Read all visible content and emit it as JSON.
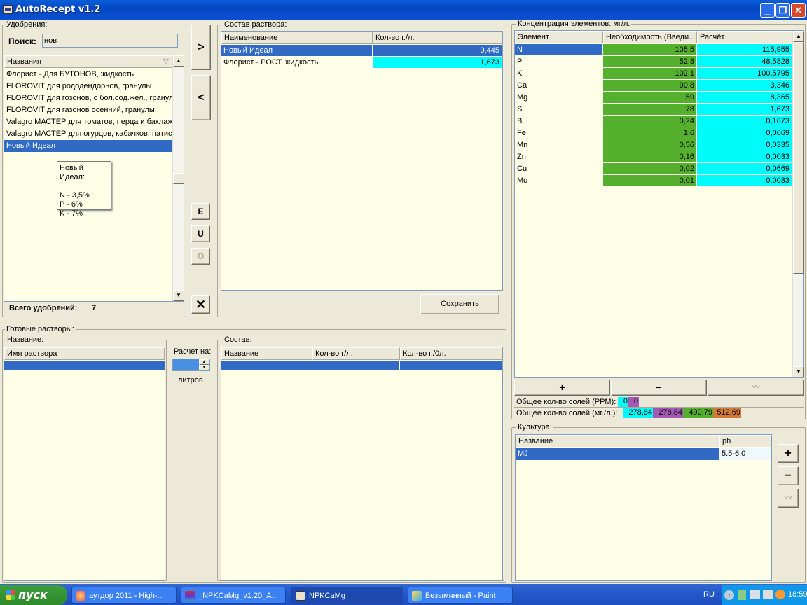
{
  "window": {
    "title": "AutoRecept v1.2",
    "controls": [
      "_",
      "❐",
      "✕"
    ]
  },
  "fertilizers": {
    "group_title": "Удобрения:",
    "search_label": "Поиск:",
    "search_value": "нов",
    "column": "Названия",
    "items": [
      "Флорист - Для БУТОНОВ, жидкость",
      "FLOROVIT для рододендорнов, гранулы",
      "FLOROVIT для гозонов, с бол.сод.жел., гранулы",
      "FLOROVIT для газонов осенний, гранулы",
      "Valagro МАСТЕР для томатов, перца и баклажанов",
      "Valagro МАСТЕР для огурцов, кабачков, патиссонов",
      "Новый Идеал"
    ],
    "selected_index": 6,
    "tooltip_title": "Новый Идеал:",
    "tooltip_lines": [
      "N - 3,5%",
      "P - 6%",
      "K - 7%"
    ],
    "total_label": "Всего удобрений:",
    "total_value": "7"
  },
  "middle_buttons": {
    "add": ">",
    "remove": "<",
    "e": "E",
    "u": "U",
    "o": "O",
    "clear": "✕"
  },
  "solution": {
    "group_title": "Состав раствора:",
    "col_name": "Наименование",
    "col_qty": "Кол-во г./л.",
    "rows": [
      {
        "name": "Новый Идеал",
        "qty": "0,445"
      },
      {
        "name": "Флорист - РОСТ, жидкость",
        "qty": "1,673"
      }
    ],
    "save_label": "Сохранить"
  },
  "concentration": {
    "group_title": "Концентрация элементов: мг/л.",
    "col_element": "Элемент",
    "col_required": "Необходимость (Введи...",
    "col_calc": "Расчёт",
    "rows": [
      {
        "el": "N",
        "req": "105,5",
        "calc": "115,955"
      },
      {
        "el": "P",
        "req": "52,8",
        "calc": "48,5828"
      },
      {
        "el": "K",
        "req": "102,1",
        "calc": "100,5795"
      },
      {
        "el": "Ca",
        "req": "90,8",
        "calc": "3,346"
      },
      {
        "el": "Mg",
        "req": "59",
        "calc": "8,365"
      },
      {
        "el": "S",
        "req": "78",
        "calc": "1,673"
      },
      {
        "el": "B",
        "req": "0,24",
        "calc": "0,1673"
      },
      {
        "el": "Fe",
        "req": "1,6",
        "calc": "0,0669"
      },
      {
        "el": "Mn",
        "req": "0,56",
        "calc": "0,0335"
      },
      {
        "el": "Zn",
        "req": "0,16",
        "calc": "0,0033"
      },
      {
        "el": "Cu",
        "req": "0,02",
        "calc": "0,0669"
      },
      {
        "el": "Mo",
        "req": "0,01",
        "calc": "0,0033"
      }
    ],
    "plus": "+",
    "minus": "−",
    "ppm_label": "Общее кол-во солей (PPM):",
    "ppm_values": [
      "0",
      "0"
    ],
    "mg_label": "Общее кол-во солей (мг./л.):",
    "mg_values": [
      "278,84",
      "278,84",
      "490,79",
      "512,69"
    ],
    "colors": {
      "cyan": "#00fbfb",
      "green": "#55b02e",
      "purple": "#a45ab4",
      "orange": "#d47a3a"
    }
  },
  "ready": {
    "group_title": "Готовые растворы:",
    "name_group": "Название:",
    "col_name": "Имя раствора",
    "calc_label": "Расчет на:",
    "liters_label": "литров"
  },
  "composition": {
    "group_title": "Состав:",
    "col_name": "Название",
    "col_qty": "Кол-во г/л.",
    "col_qty0": "Кол-во г./0л."
  },
  "culture": {
    "group_title": "Культура:",
    "col_name": "Название",
    "col_ph": "ph",
    "rows": [
      {
        "name": "MJ",
        "ph": "5.5-6.0"
      }
    ],
    "plus": "+",
    "minus": "−"
  },
  "taskbar": {
    "start": "пуск",
    "tasks": [
      "аутдор 2011 - High-...",
      "_NPKCaMg_v1.20_A...",
      "NPKCaMg",
      "Безымянный - Paint"
    ],
    "lang": "RU",
    "time": "18:59"
  }
}
